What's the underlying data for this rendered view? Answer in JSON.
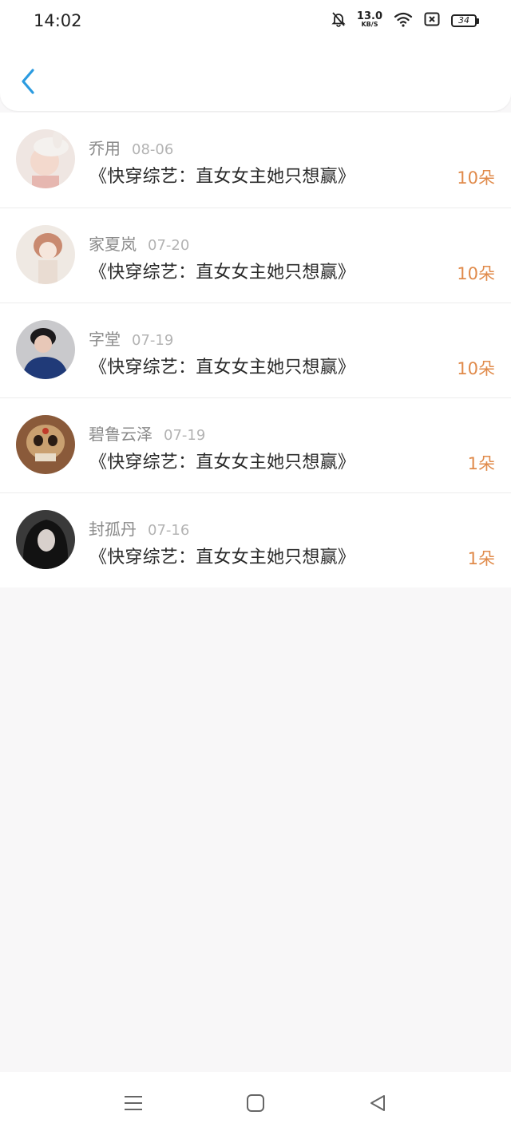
{
  "status_bar": {
    "time": "14:02",
    "speed_value": "13.0",
    "speed_unit": "KB/S",
    "battery": "34"
  },
  "header": {
    "back_icon": "chevron-left-icon",
    "accent_color": "#2b9be0"
  },
  "gifts": {
    "items": [
      {
        "name": "乔用",
        "date": "08-06",
        "book": "《快穿综艺：直女女主她只想赢》",
        "amount": "10朵"
      },
      {
        "name": "家夏岚",
        "date": "07-20",
        "book": "《快穿综艺：直女女主她只想赢》",
        "amount": "10朵"
      },
      {
        "name": "字堂",
        "date": "07-19",
        "book": "《快穿综艺：直女女主她只想赢》",
        "amount": "10朵"
      },
      {
        "name": "碧鲁云泽",
        "date": "07-19",
        "book": "《快穿综艺：直女女主她只想赢》",
        "amount": "1朵"
      },
      {
        "name": "封孤丹",
        "date": "07-16",
        "book": "《快穿综艺：直女女主她只想赢》",
        "amount": "1朵"
      }
    ],
    "amount_color": "#e08a4a"
  },
  "nav_bar": {
    "icons": [
      "menu-icon",
      "home-square-icon",
      "back-triangle-icon"
    ]
  }
}
